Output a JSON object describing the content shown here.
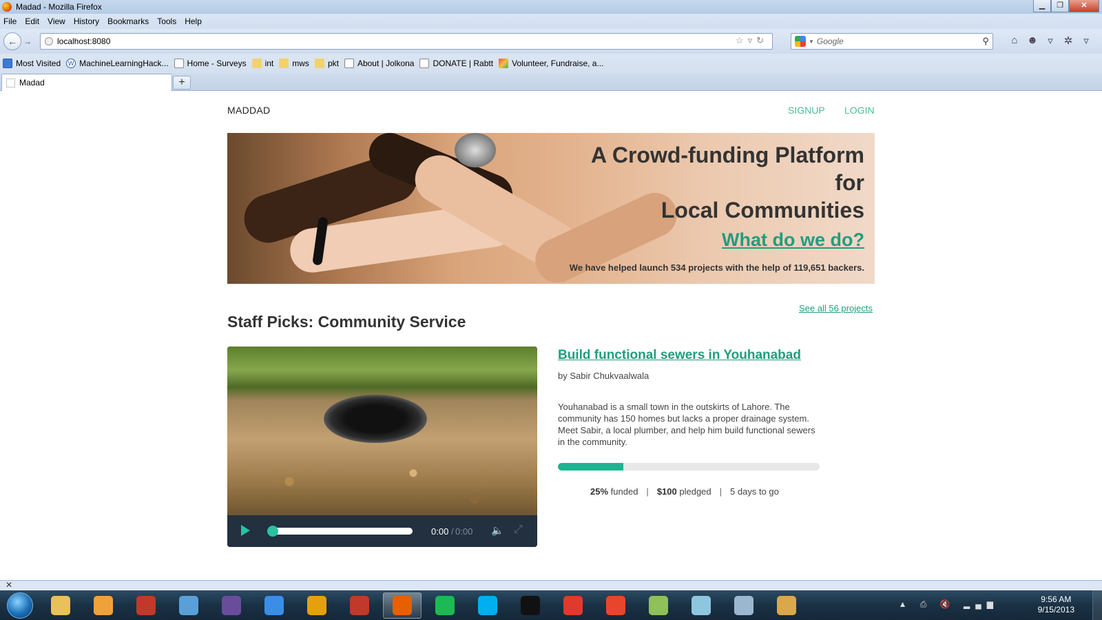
{
  "window": {
    "title": "Madad - Mozilla Firefox",
    "minimize": "▁",
    "maximize": "❐",
    "close": "✕"
  },
  "menu": [
    "File",
    "Edit",
    "View",
    "History",
    "Bookmarks",
    "Tools",
    "Help"
  ],
  "nav": {
    "url": "localhost:8080",
    "search_placeholder": "Google"
  },
  "bookmarks": [
    {
      "label": "Most Visited",
      "icon": "most-visited-icon"
    },
    {
      "label": "MachineLearningHack...",
      "icon": "wordpress-icon"
    },
    {
      "label": "Home - Surveys",
      "icon": "page-icon"
    },
    {
      "label": "int",
      "icon": "folder-icon"
    },
    {
      "label": "mws",
      "icon": "folder-icon"
    },
    {
      "label": "pkt",
      "icon": "folder-icon"
    },
    {
      "label": "About | Jolkona",
      "icon": "page-icon"
    },
    {
      "label": "DONATE | Rabtt",
      "icon": "page-icon"
    },
    {
      "label": "Volunteer, Fundraise, a...",
      "icon": "volunteer-icon"
    }
  ],
  "tab": {
    "label": "Madad",
    "new_tab": "+"
  },
  "site": {
    "logo": "MADDAD",
    "signup": "SIGNUP",
    "login": "LOGIN",
    "hero": {
      "title_line1": "A Crowd-funding Platform",
      "title_line2": "for",
      "title_line3": "Local Communities",
      "cta": "What do we do?",
      "stats": "We have helped launch 534 projects with the help of 119,651 backers."
    },
    "see_all": "See all 56 projects",
    "section_title": "Staff Picks: Community Service",
    "project": {
      "title": "Build functional sewers in Youhanabad",
      "author": "by Sabir Chukvaalwala",
      "description": "Youhanabad is a small town in the outskirts of Lahore. The community has 150 homes but lacks a proper drainage system. Meet Sabir, a local plumber, and help him build functional sewers in the community.",
      "funded_percent": 25,
      "funded_value": "25%",
      "funded_label": "funded",
      "pledged_value": "$100",
      "pledged_label": "pledged",
      "days": "5 days to go",
      "separator": "|"
    },
    "player": {
      "time_current": "0:00",
      "time_separator": "/",
      "time_total": "0:00"
    }
  },
  "taskbar": {
    "apps": [
      {
        "icon": "explorer-icon",
        "color": "#e8c15a"
      },
      {
        "icon": "outlook-icon",
        "color": "#f0a23a"
      },
      {
        "icon": "filezilla-icon",
        "color": "#c0392b"
      },
      {
        "icon": "chrome-icon",
        "color": "#5aa0d8"
      },
      {
        "icon": "eclipse-icon",
        "color": "#6a4c9c"
      },
      {
        "icon": "ie-icon",
        "color": "#3a8ee6"
      },
      {
        "icon": "plex-icon",
        "color": "#e5a00d"
      },
      {
        "icon": "dots-app-icon",
        "color": "#c0392b"
      },
      {
        "icon": "firefox-icon",
        "color": "#e66000"
      },
      {
        "icon": "spotify-icon",
        "color": "#1db954"
      },
      {
        "icon": "skype-icon",
        "color": "#00aff0"
      },
      {
        "icon": "cmd-icon",
        "color": "#111111"
      },
      {
        "icon": "beats-icon",
        "color": "#e03a2e"
      },
      {
        "icon": "git-icon",
        "color": "#e8452c"
      },
      {
        "icon": "notepad-icon",
        "color": "#8fc05a"
      },
      {
        "icon": "snipping-icon",
        "color": "#8ec6e0"
      },
      {
        "icon": "calculator-icon",
        "color": "#9bb7d0"
      },
      {
        "icon": "paint-icon",
        "color": "#d9a84a"
      }
    ],
    "time": "9:56 AM",
    "date": "9/15/2013"
  },
  "colors": {
    "accent": "#1f9e7e",
    "progress": "#1cb391",
    "player_bg": "#22303f"
  }
}
